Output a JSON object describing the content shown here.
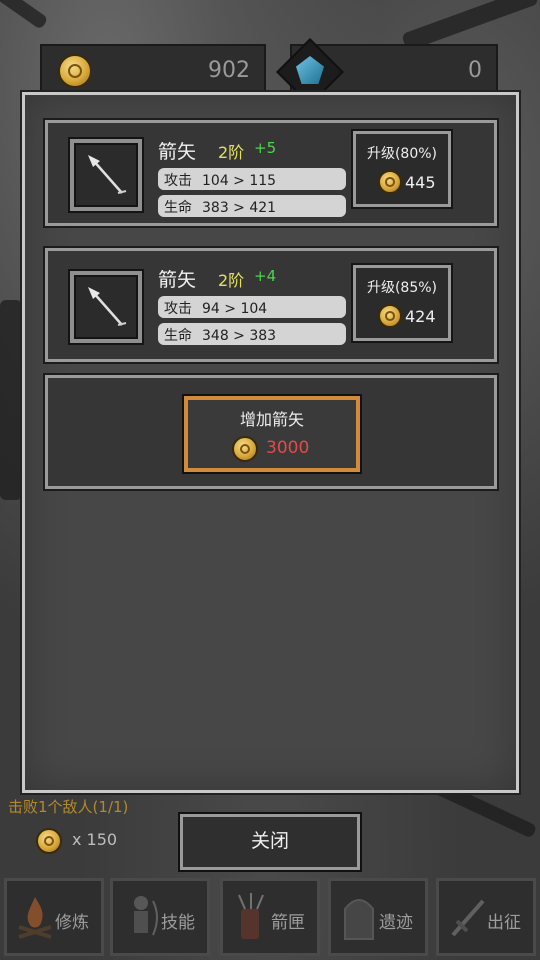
{
  "currency": {
    "gold": "902",
    "gems": "0"
  },
  "cards": [
    {
      "name": "箭矢",
      "tier": "2阶",
      "bonus": "+5",
      "attack_label": "攻击",
      "attack_value": "104 > 115",
      "hp_label": "生命",
      "hp_value": "383 > 421",
      "upgrade_label": "升级(80%)",
      "upgrade_cost": "445"
    },
    {
      "name": "箭矢",
      "tier": "2阶",
      "bonus": "+4",
      "attack_label": "攻击",
      "attack_value": "94 > 104",
      "hp_label": "生命",
      "hp_value": "348 > 383",
      "upgrade_label": "升级(85%)",
      "upgrade_cost": "424"
    }
  ],
  "add_arrow": {
    "label": "增加箭矢",
    "cost": "3000"
  },
  "quest": {
    "text": "击败1个敌人(1/1)",
    "reward": "x 150"
  },
  "close_label": "关闭",
  "nav": [
    "修炼",
    "技能",
    "箭匣",
    "遗迹",
    "出征"
  ],
  "colors": {
    "tier": "#e6e060",
    "bonus": "#4fd34f",
    "insufficient_cost": "#e34a4a",
    "highlight_border": "#d38a3a"
  }
}
